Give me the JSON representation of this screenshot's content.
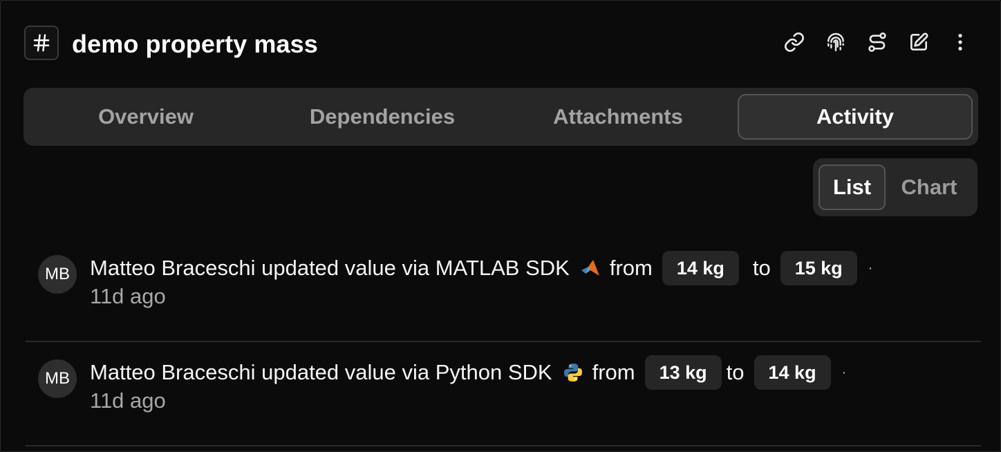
{
  "header": {
    "title": "demo property mass",
    "icons": [
      "link-icon",
      "fingerprint-icon",
      "route-icon",
      "edit-icon",
      "more-vertical-icon"
    ]
  },
  "tabs": [
    {
      "label": "Overview",
      "active": false
    },
    {
      "label": "Dependencies",
      "active": false
    },
    {
      "label": "Attachments",
      "active": false
    },
    {
      "label": "Activity",
      "active": true
    }
  ],
  "view_toggle": {
    "list": "List",
    "chart": "Chart",
    "selected": "List"
  },
  "activity": [
    {
      "avatar": "MB",
      "text": "Matteo Braceschi updated value via MATLAB SDK",
      "sdk_icon": "matlab-icon",
      "from_word": "from",
      "from_value": "14 kg",
      "to_word": "to",
      "to_value": "15 kg",
      "separator": "·",
      "time": "11d ago"
    },
    {
      "avatar": "MB",
      "text": "Matteo Braceschi updated value via Python SDK",
      "sdk_icon": "python-icon",
      "from_word": "from",
      "from_value": "13 kg",
      "to_word": "to",
      "to_value": "14 kg",
      "separator": "·",
      "time": "11d ago"
    }
  ],
  "colors": {
    "background": "#0b0b0b",
    "panel": "#272727",
    "pill": "#262626",
    "muted_text": "#a3a3a3"
  }
}
